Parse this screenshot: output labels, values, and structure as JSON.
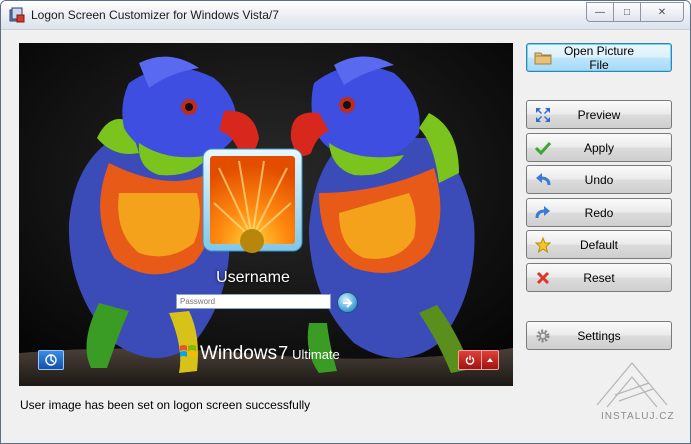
{
  "window": {
    "title": "Logon Screen Customizer for Windows Vista/7"
  },
  "caption_buttons": {
    "minimize": "—",
    "maximize": "□",
    "close": "✕"
  },
  "preview": {
    "username": "Username",
    "password_placeholder": "Password",
    "brand_windows": "Windows",
    "brand_version": "7",
    "brand_edition": "Ultimate"
  },
  "buttons": {
    "open": "Open Picture File",
    "preview": "Preview",
    "apply": "Apply",
    "undo": "Undo",
    "redo": "Redo",
    "default": "Default",
    "reset": "Reset",
    "settings": "Settings"
  },
  "icons": {
    "open": "folder-icon",
    "preview": "expand-icon",
    "apply": "checkmark-icon",
    "undo": "undo-arrow-icon",
    "redo": "redo-arrow-icon",
    "default": "star-icon",
    "reset": "x-icon",
    "settings": "gear-icon"
  },
  "status": {
    "message": "User image has been set on logon screen successfully"
  },
  "watermark": {
    "text": "INSTALUJ.CZ"
  }
}
